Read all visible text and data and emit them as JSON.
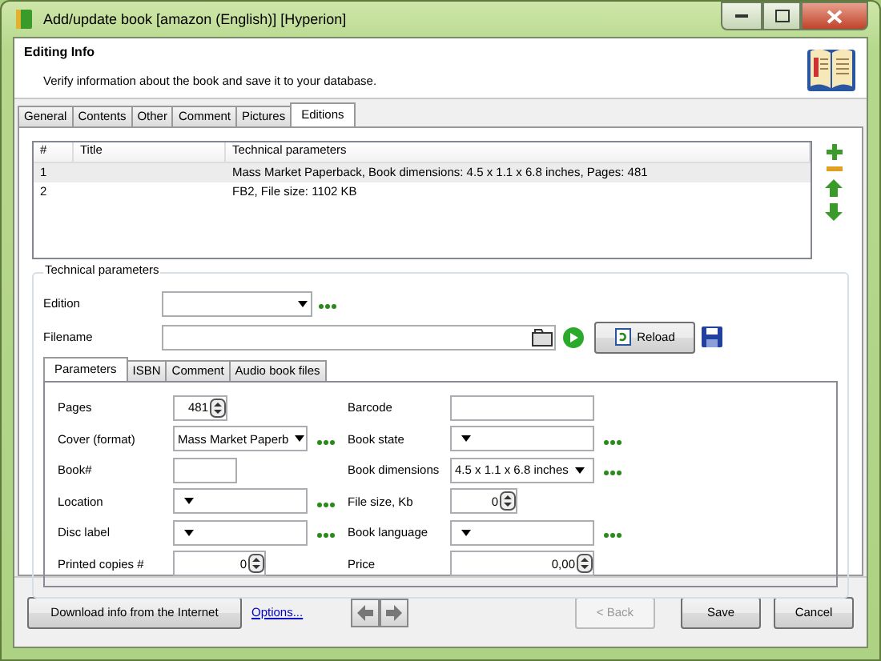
{
  "window": {
    "title": "Add/update book [amazon (English)] [Hyperion]"
  },
  "header": {
    "title": "Editing Info",
    "subtitle": "Verify information about the book and save it to your database."
  },
  "tabs": [
    {
      "label": "General",
      "selected": false
    },
    {
      "label": "Contents",
      "selected": false
    },
    {
      "label": "Other",
      "selected": false
    },
    {
      "label": "Comment",
      "selected": false
    },
    {
      "label": "Pictures",
      "selected": false
    },
    {
      "label": "Editions",
      "selected": true
    }
  ],
  "editions": {
    "columns": [
      "#",
      "Title",
      "Technical parameters"
    ],
    "rows": [
      {
        "number": "1",
        "title": "",
        "parameters": "Mass Market Paperback, Book dimensions: 4.5 x 1.1 x 6.8 inches, Pages: 481",
        "selected": true
      },
      {
        "number": "2",
        "title": "",
        "parameters": "FB2, File size: 1102 KB",
        "selected": false
      }
    ]
  },
  "technical_parameters": {
    "title": "Technical parameters",
    "edition_label": "Edition",
    "filename_label": "Filename",
    "reload_button": "Reload",
    "tabs": [
      {
        "label": "Parameters",
        "selected": true
      },
      {
        "label": "ISBN",
        "selected": false
      },
      {
        "label": "Comment",
        "selected": false
      },
      {
        "label": "Audio book files",
        "selected": false
      }
    ],
    "left_fields": [
      {
        "label": "Pages",
        "kind": "spin",
        "value": "481",
        "more": false
      },
      {
        "label": "Cover (format)",
        "kind": "select",
        "value": "Mass Market Paperb",
        "more": true
      },
      {
        "label": "Book#",
        "kind": "short",
        "more": false
      },
      {
        "label": "Location",
        "kind": "select",
        "more": true
      },
      {
        "label": "Disc label",
        "kind": "select",
        "more": true
      },
      {
        "label": "Printed copies #",
        "kind": "spin",
        "value": "0",
        "more": false
      }
    ],
    "right_fields": [
      {
        "label": "Barcode",
        "kind": "text",
        "more": false
      },
      {
        "label": "Book state",
        "kind": "select",
        "more": true
      },
      {
        "label": "Book dimensions",
        "kind": "select",
        "value": "4.5 x 1.1 x 6.8 inches",
        "more": true
      },
      {
        "label": "File size, Kb",
        "kind": "spin",
        "value": "0",
        "more": false
      },
      {
        "label": "Book language",
        "kind": "select",
        "more": true
      },
      {
        "label": "Price",
        "kind": "spin",
        "value": "0,00",
        "more": false
      }
    ]
  },
  "footer": {
    "download_button": "Download info from the Internet",
    "options_link": "Options...",
    "back_button": {
      "label": "< Back",
      "disabled": true
    },
    "save_button": "Save",
    "cancel_button": "Cancel"
  }
}
